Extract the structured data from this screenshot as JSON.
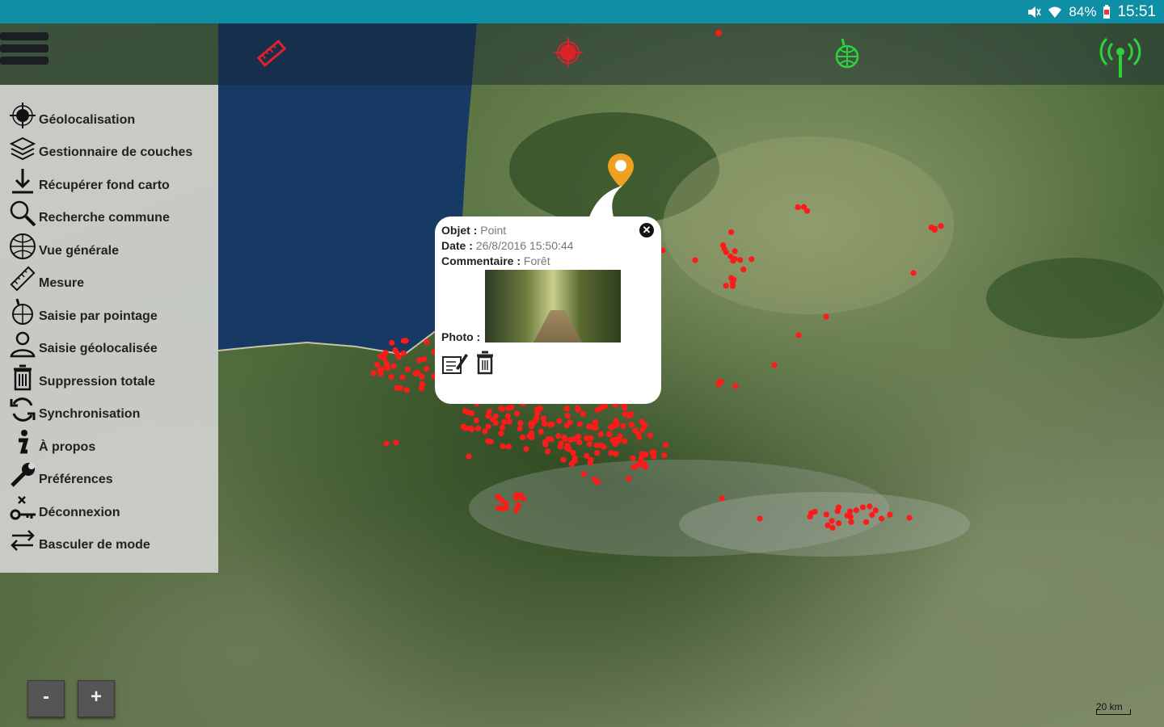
{
  "status_bar": {
    "battery": "84%",
    "time": "15:51"
  },
  "colors": {
    "status_bar": "#0e8fa6",
    "point_marker": "#ff1a1a",
    "location_pin": "#f0a020",
    "sync_icon": "#2fd13a"
  },
  "toolbar": {
    "icons": [
      "menu-icon",
      "ruler-icon",
      "crosshair-icon",
      "globe-point-icon",
      "antenna-icon"
    ]
  },
  "menu": {
    "items": [
      {
        "icon": "crosshair-icon",
        "label": "Géolocalisation"
      },
      {
        "icon": "layers-icon",
        "label": "Gestionnaire de couches"
      },
      {
        "icon": "download-icon",
        "label": "Récupérer fond carto"
      },
      {
        "icon": "search-icon",
        "label": "Recherche commune"
      },
      {
        "icon": "globe-icon",
        "label": "Vue générale"
      },
      {
        "icon": "ruler-icon",
        "label": "Mesure"
      },
      {
        "icon": "globe-point-icon",
        "label": "Saisie par pointage"
      },
      {
        "icon": "user-location-icon",
        "label": "Saisie géolocalisée"
      },
      {
        "icon": "trash-icon",
        "label": "Suppression totale"
      },
      {
        "icon": "sync-icon",
        "label": "Synchronisation"
      },
      {
        "icon": "info-icon",
        "label": "À propos"
      },
      {
        "icon": "wrench-icon",
        "label": "Préférences"
      },
      {
        "icon": "logout-icon",
        "label": "Déconnexion"
      },
      {
        "icon": "swap-icon",
        "label": "Basculer de mode"
      }
    ]
  },
  "popup": {
    "objet_label": "Objet :",
    "objet_value": "Point",
    "date_label": "Date :",
    "date_value": "26/8/2016 15:50:44",
    "commentaire_label": "Commentaire :",
    "commentaire_value": "Forêt",
    "photo_label": "Photo :",
    "close_glyph": "✕",
    "actions": [
      "edit-icon",
      "trash-icon"
    ]
  },
  "zoom": {
    "out_label": "-",
    "in_label": "+"
  },
  "scale_text": "20 km"
}
